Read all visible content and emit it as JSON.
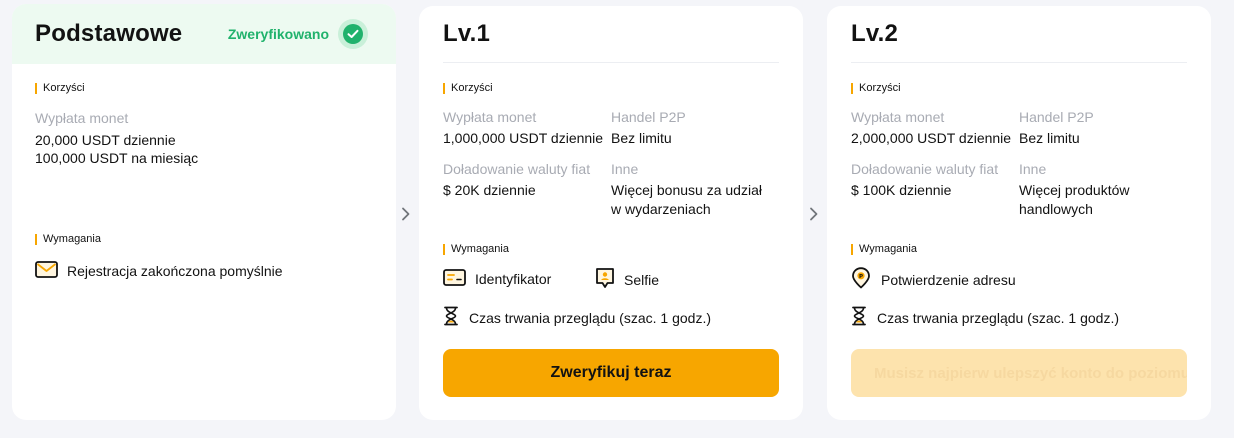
{
  "basic": {
    "title": "Podstawowe",
    "status": "Zweryfikowano",
    "benefits_label": "Korzyści",
    "withdrawal_label": "Wypłata monet",
    "withdrawal_daily": "20,000 USDT dziennie",
    "withdrawal_monthly": "100,000 USDT na miesiąc",
    "requirements_label": "Wymagania",
    "requirement": "Rejestracja zakończona pomyślnie"
  },
  "lv1": {
    "title": "Lv.1",
    "benefits_label": "Korzyści",
    "withdrawal_label": "Wypłata monet",
    "withdrawal_value": "1,000,000 USDT dziennie",
    "p2p_label": "Handel P2P",
    "p2p_value": "Bez limitu",
    "fiat_label": "Doładowanie waluty fiat",
    "fiat_value": "$ 20K dziennie",
    "other_label": "Inne",
    "other_value_line1": "Więcej bonusu za udział",
    "other_value_line2": "w wydarzeniach",
    "requirements_label": "Wymagania",
    "req_id": "Identyfikator",
    "req_selfie": "Selfie",
    "review_time": "Czas trwania przeglądu (szac. 1 godz.)",
    "button": "Zweryfikuj teraz"
  },
  "lv2": {
    "title": "Lv.2",
    "benefits_label": "Korzyści",
    "withdrawal_label": "Wypłata monet",
    "withdrawal_value": "2,000,000 USDT dziennie",
    "p2p_label": "Handel P2P",
    "p2p_value": "Bez limitu",
    "fiat_label": "Doładowanie waluty fiat",
    "fiat_value": "$ 100K dziennie",
    "other_label": "Inne",
    "other_value_line1": "Więcej produktów",
    "other_value_line2": "handlowych",
    "requirements_label": "Wymagania",
    "req_address": "Potwierdzenie adresu",
    "review_time": "Czas trwania przeglądu (szac. 1 godz.)",
    "button": "Musisz najpierw ulepszyć konto do poziomu 1"
  },
  "colors": {
    "accent": "#f7a600",
    "success": "#20b26c",
    "muted_text": "#a8abb3",
    "background": "#f4f5f9"
  },
  "icons": [
    "check-icon",
    "envelope-icon",
    "id-card-icon",
    "selfie-icon",
    "hourglass-icon",
    "location-pin-icon",
    "chevron-right-icon"
  ]
}
